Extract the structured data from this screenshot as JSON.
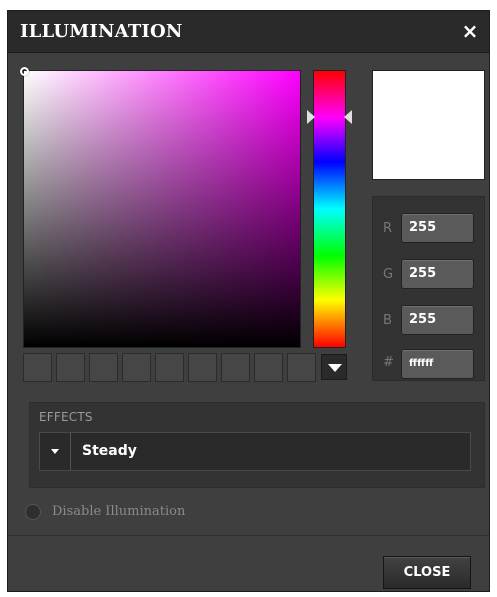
{
  "dialog": {
    "title": "ILLUMINATION",
    "close_icon_glyph": "×"
  },
  "picker": {
    "selected_color": "#ffffff",
    "hue_color": "#ff00ff",
    "hue_fraction_from_top": 0.17,
    "saturation": 0,
    "value": 1,
    "swatches": [
      "",
      "",
      "",
      "",
      "",
      "",
      "",
      "",
      ""
    ],
    "swatch_dropdown_icon": "chevron-down-icon"
  },
  "rgb": {
    "r_label": "R",
    "r_value": "255",
    "g_label": "G",
    "g_value": "255",
    "b_label": "B",
    "b_value": "255",
    "hex_label": "#",
    "hex_value": "ffffff"
  },
  "effects": {
    "label": "EFFECTS",
    "selected": "Steady"
  },
  "disable": {
    "label": "Disable Illumination",
    "checked": false
  },
  "footer": {
    "close_label": "CLOSE"
  }
}
